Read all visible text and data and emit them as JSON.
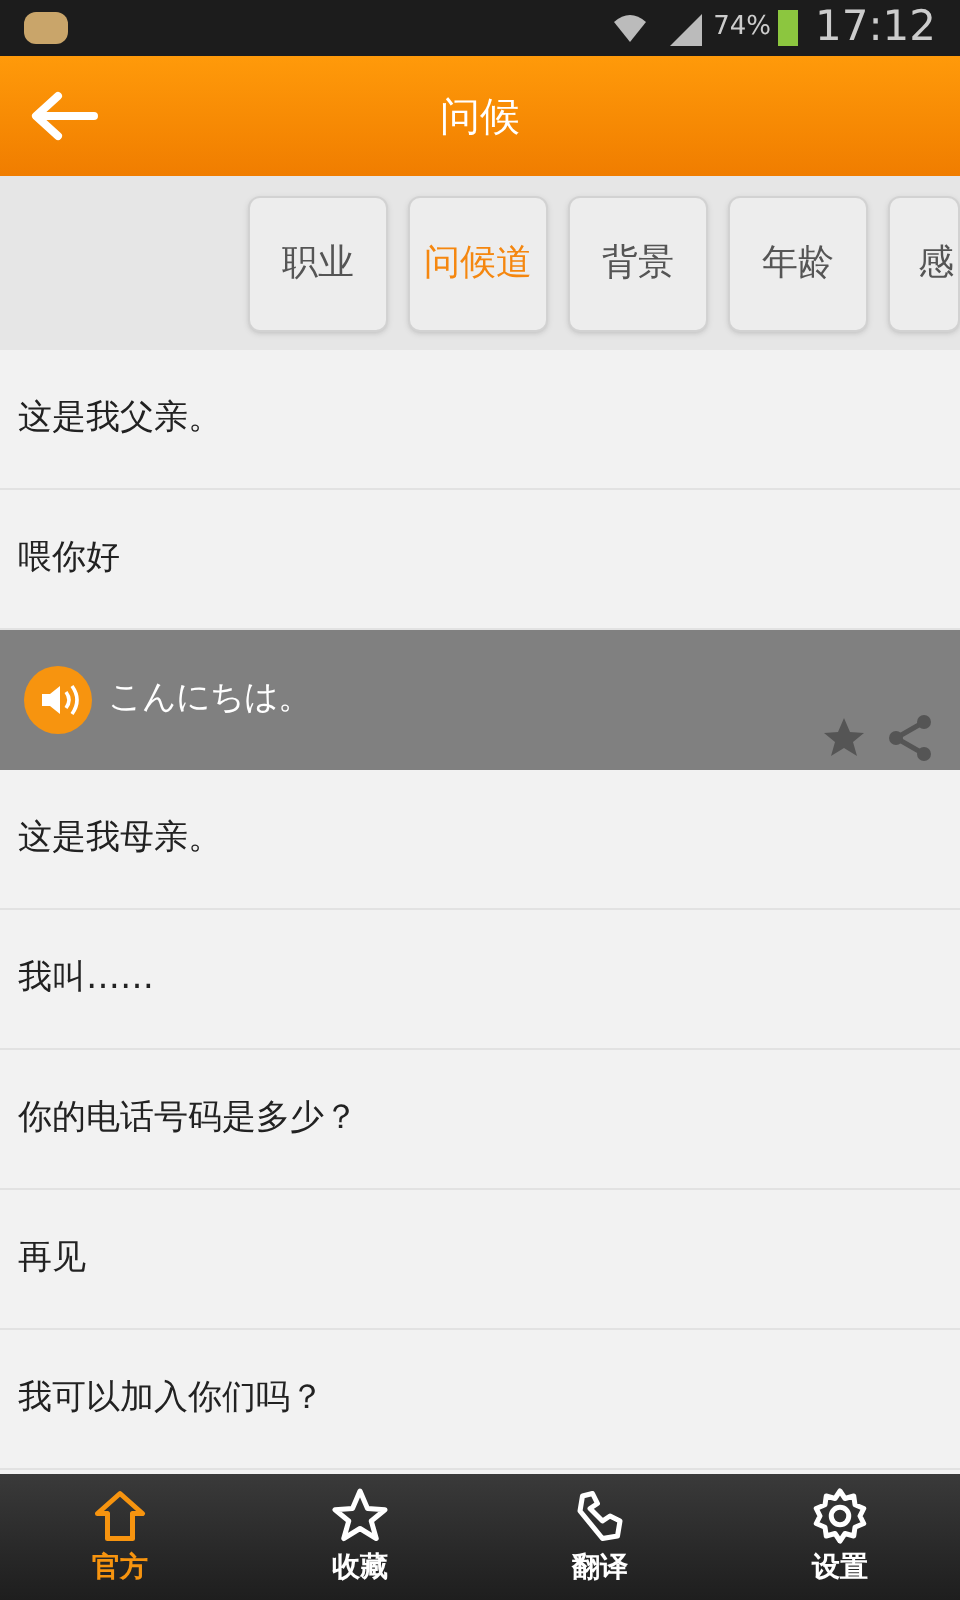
{
  "status_bar": {
    "battery": "74%",
    "time": "17:12"
  },
  "header": {
    "title": "问候"
  },
  "categories": [
    {
      "label": "职业",
      "selected": false
    },
    {
      "label": "问候道",
      "selected": true
    },
    {
      "label": "背景",
      "selected": false
    },
    {
      "label": "年龄",
      "selected": false
    },
    {
      "label": "感",
      "selected": false
    }
  ],
  "phrases": [
    {
      "text": "这是我父亲。",
      "expanded": false
    },
    {
      "text": "喂你好",
      "expanded": false
    },
    {
      "text": "こんにちは。",
      "expanded": true
    },
    {
      "text": "这是我母亲。",
      "expanded": false
    },
    {
      "text": "我叫……",
      "expanded": false
    },
    {
      "text": "你的电话号码是多少？",
      "expanded": false
    },
    {
      "text": "再见",
      "expanded": false
    },
    {
      "text": "我可以加入你们吗？",
      "expanded": false
    }
  ],
  "bottom_nav": [
    {
      "label": "官方",
      "selected": true
    },
    {
      "label": "收藏",
      "selected": false
    },
    {
      "label": "翻译",
      "selected": false
    },
    {
      "label": "设置",
      "selected": false
    }
  ]
}
